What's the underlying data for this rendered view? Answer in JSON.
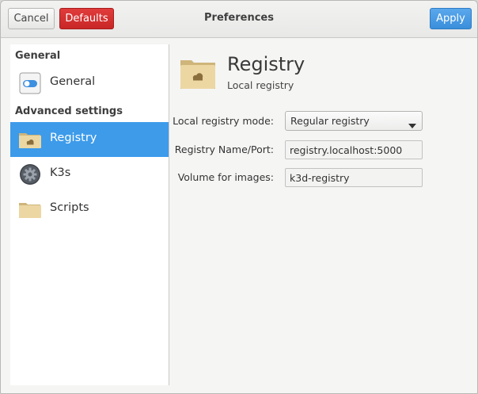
{
  "window": {
    "title": "Preferences"
  },
  "header": {
    "cancel_label": "Cancel",
    "defaults_label": "Defaults",
    "apply_label": "Apply"
  },
  "sidebar": {
    "sections": [
      "General",
      "Advanced settings"
    ],
    "items": [
      {
        "label": "General",
        "icon": "toggle-switch-icon"
      },
      {
        "label": "Registry",
        "icon": "folder-cloud-icon",
        "selected": true
      },
      {
        "label": "K3s",
        "icon": "gear-icon"
      },
      {
        "label": "Scripts",
        "icon": "folder-icon"
      }
    ]
  },
  "main": {
    "title": "Registry",
    "subtitle": "Local registry",
    "fields": {
      "mode": {
        "label": "Local registry mode:",
        "value": "Regular registry"
      },
      "name_port": {
        "label": "Registry Name/Port:",
        "value": "registry.localhost:5000"
      },
      "volume": {
        "label": "Volume for images:",
        "value": "k3d-registry"
      }
    }
  },
  "colors": {
    "accent": "#3d9bea",
    "destructive": "#d93232",
    "folder": "#ecd7a3"
  }
}
